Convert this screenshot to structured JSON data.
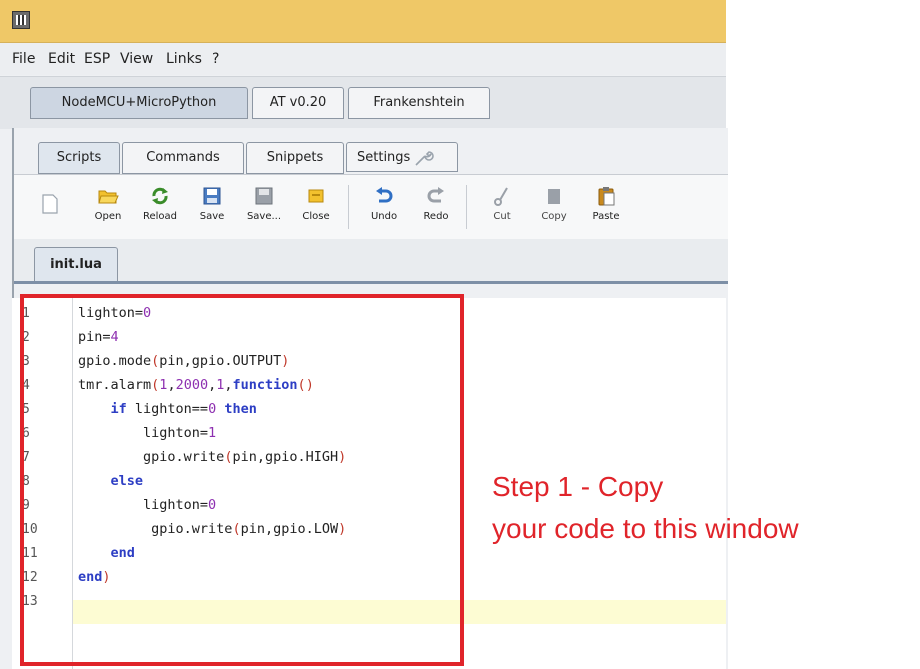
{
  "menu": [
    "File",
    "Edit",
    "ESP",
    "View",
    "Links",
    "?"
  ],
  "firmware_tabs": [
    {
      "label": "NodeMCU+MicroPython",
      "active": true
    },
    {
      "label": "AT v0.20",
      "active": false
    },
    {
      "label": "Frankenshtein",
      "active": false
    }
  ],
  "panel_tabs": [
    {
      "label": "Scripts",
      "active": true
    },
    {
      "label": "Commands",
      "active": false
    },
    {
      "label": "Snippets",
      "active": false
    },
    {
      "label": "Settings",
      "active": false,
      "icon": "wrench-icon"
    }
  ],
  "toolbar": {
    "new_icon": "new-file-icon",
    "open": "Open",
    "reload": "Reload",
    "save": "Save",
    "save_as": "Save...",
    "close": "Close",
    "undo": "Undo",
    "redo": "Redo",
    "cut": "Cut",
    "copy": "Copy",
    "paste": "Paste"
  },
  "file_tab": "init.lua",
  "code": {
    "line_numbers": [
      "1",
      "2",
      "3",
      "4",
      "5",
      "6",
      "7",
      "8",
      "9",
      "10",
      "11",
      "12",
      "13"
    ],
    "lines": [
      "lighton=0",
      "pin=4",
      "gpio.mode(pin,gpio.OUTPUT)",
      "tmr.alarm(1,2000,1,function()",
      "    if lighton==0 then",
      "        lighton=1",
      "        gpio.write(pin,gpio.HIGH)",
      "    else",
      "        lighton=0",
      "         gpio.write(pin,gpio.LOW)",
      "    end",
      "end)",
      ""
    ],
    "current_line": 13
  },
  "annotation": {
    "line1": "Step 1 - Copy",
    "line2": "your code to this window"
  },
  "colors": {
    "titlebar": "#efc867",
    "annotation_red": "#e0242a",
    "keyword_blue": "#2d3ec4",
    "number_purple": "#8d2fb0",
    "current_line": "#fdfcd3"
  }
}
